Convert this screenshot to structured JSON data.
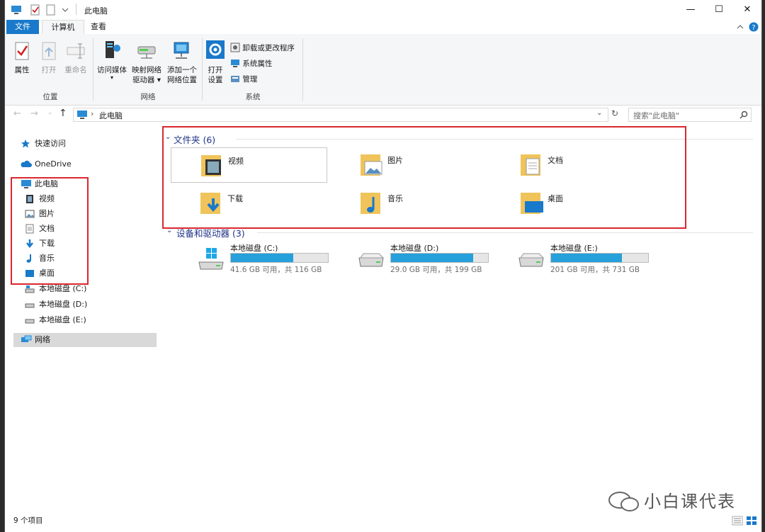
{
  "window": {
    "title": "此电脑"
  },
  "window_buttons": {
    "minimize": "—",
    "maximize": "☐",
    "close": "✕"
  },
  "ribbon": {
    "tabs": [
      "文件",
      "计算机",
      "查看"
    ],
    "groups": {
      "location": {
        "label": "位置",
        "buttons": [
          "属性",
          "打开",
          "重命名"
        ]
      },
      "network": {
        "label": "网络",
        "buttons": [
          {
            "line1": "访问媒体",
            "line2": "▾"
          },
          {
            "line1": "映射网络",
            "line2": "驱动器 ▾"
          },
          {
            "line1": "添加一个",
            "line2": "网络位置"
          }
        ]
      },
      "system": {
        "label": "系统",
        "open_settings": {
          "line1": "打开",
          "line2": "设置"
        },
        "small": [
          "卸载或更改程序",
          "系统属性",
          "管理"
        ]
      }
    }
  },
  "address": {
    "breadcrumb": "此电脑",
    "search_placeholder": "搜索\"此电脑\""
  },
  "nav": {
    "quick_access": "快速访问",
    "onedrive": "OneDrive",
    "this_pc": "此电脑",
    "children": [
      "视频",
      "图片",
      "文档",
      "下载",
      "音乐",
      "桌面",
      "本地磁盘 (C:)",
      "本地磁盘 (D:)",
      "本地磁盘 (E:)"
    ],
    "network": "网络"
  },
  "folders": {
    "header": "文件夹 (6)",
    "items": [
      "视频",
      "图片",
      "文档",
      "下载",
      "音乐",
      "桌面"
    ]
  },
  "drives": {
    "header": "设备和驱动器 (3)",
    "items": [
      {
        "name": "本地磁盘 (C:)",
        "free": "41.6 GB 可用，共 116 GB",
        "used_fraction": 0.64
      },
      {
        "name": "本地磁盘 (D:)",
        "free": "29.0 GB 可用，共 199 GB",
        "used_fraction": 0.85
      },
      {
        "name": "本地磁盘 (E:)",
        "free": "201 GB 可用，共 731 GB",
        "used_fraction": 0.73
      }
    ]
  },
  "status": {
    "count": "9 个项目"
  },
  "watermark": "小白课代表",
  "colors": {
    "accent": "#1979ca",
    "drive_bar": "#26a0da",
    "highlight_box": "#d9282e",
    "section_header": "#1e3287"
  }
}
